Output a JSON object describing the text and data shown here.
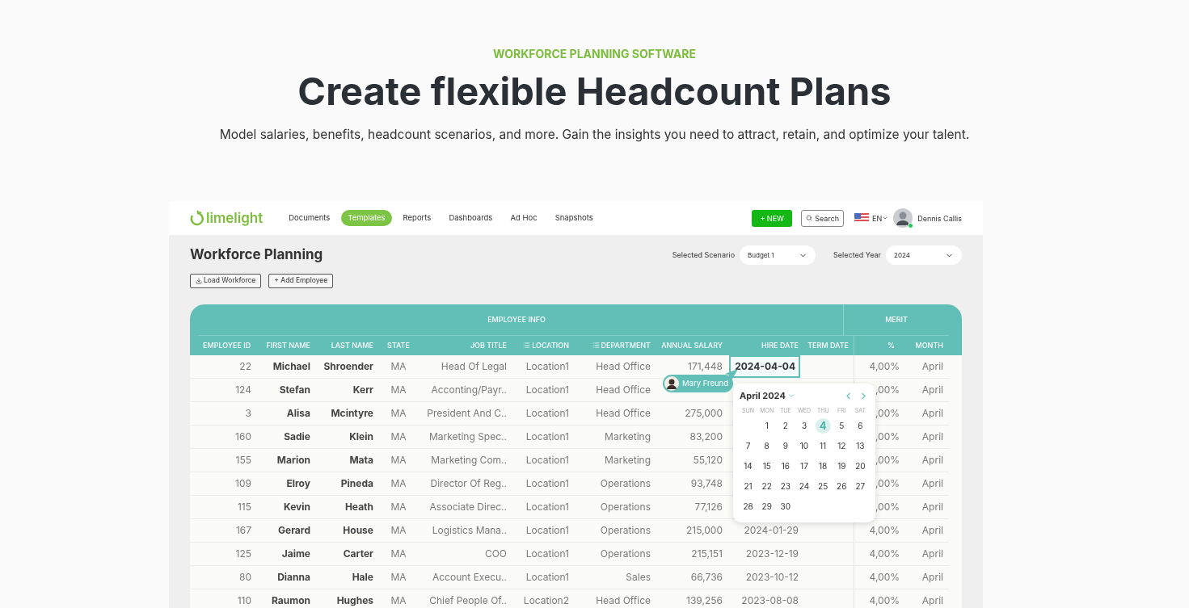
{
  "hero": {
    "eyebrow": "WORKFORCE PLANNING SOFTWARE",
    "title": "Create flexible Headcount Plans",
    "subtitle": "Model salaries, benefits, headcount scenarios, and more. Gain the insights you need to attract, retain, and optimize your talent."
  },
  "app": {
    "logo": "limelight",
    "nav": [
      {
        "label": "Documents",
        "selected": false
      },
      {
        "label": "Templates",
        "selected": true
      },
      {
        "label": "Reports",
        "selected": false
      },
      {
        "label": "Dashboards",
        "selected": false
      },
      {
        "label": "Ad Hoc",
        "selected": false
      },
      {
        "label": "Snapshots",
        "selected": false
      }
    ],
    "new_button": "+ NEW",
    "search_button": "Search",
    "language": "EN",
    "user": {
      "name": "Dennis Callis",
      "online": true
    },
    "page_title": "Workforce Planning",
    "filters": [
      {
        "label": "Selected Scenario",
        "value": "Budget 1"
      },
      {
        "label": "Selected Year",
        "value": "2024"
      }
    ],
    "actions": [
      {
        "label": "Load Workforce",
        "kind": "download"
      },
      {
        "label": "+ Add Employee",
        "kind": "plain"
      }
    ],
    "table": {
      "groups": [
        {
          "label": "EMPLOYEE INFO"
        },
        {
          "label": "MERIT"
        }
      ],
      "columns": [
        {
          "label": "EMPLOYEE ID",
          "list": false
        },
        {
          "label": "FIRST NAME",
          "list": false
        },
        {
          "label": "LAST NAME",
          "list": false
        },
        {
          "label": "STATE",
          "list": false
        },
        {
          "label": "JOB TITLE",
          "list": false
        },
        {
          "label": "LOCATION",
          "list": true
        },
        {
          "label": "DEPARTMENT",
          "list": true
        },
        {
          "label": "ANNUAL SALARY",
          "list": false
        },
        {
          "label": "HIRE DATE",
          "list": false
        },
        {
          "label": "TERM DATE",
          "list": false
        },
        {
          "label": "%",
          "list": false
        },
        {
          "label": "MONTH",
          "list": false
        }
      ],
      "rows": [
        {
          "cells": [
            "22",
            "Michael",
            "Shroender",
            "MA",
            "Head Of Legal",
            "Location1",
            "Head Office",
            "171,448",
            "2024-04-04",
            "",
            "4,00%",
            "April"
          ],
          "editing": true
        },
        {
          "cells": [
            "124",
            "Stefan",
            "Kerr",
            "MA",
            "Acconting/Payr..",
            "Location1",
            "Head Office",
            "",
            "",
            "",
            ",00%",
            "April"
          ],
          "editing": false
        },
        {
          "cells": [
            "3",
            "Alisa",
            "Mcintyre",
            "MA",
            "President And C..",
            "Location1",
            "Head Office",
            "275,000",
            "",
            "",
            ",00%",
            "April"
          ],
          "editing": false
        },
        {
          "cells": [
            "160",
            "Sadie",
            "Klein",
            "MA",
            "Marketing Spec..",
            "Location1",
            "Marketing",
            "83,200",
            "",
            "",
            ",00%",
            "April"
          ],
          "editing": false
        },
        {
          "cells": [
            "155",
            "Marion",
            "Mata",
            "MA",
            "Marketing Com..",
            "Location1",
            "Marketing",
            "55,120",
            "",
            "",
            ",00%",
            "April"
          ],
          "editing": false
        },
        {
          "cells": [
            "109",
            "Elroy",
            "Pineda",
            "MA",
            "Director Of Reg..",
            "Location1",
            "Operations",
            "93,748",
            "",
            "",
            ",00%",
            "April"
          ],
          "editing": false
        },
        {
          "cells": [
            "115",
            "Kevin",
            "Heath",
            "MA",
            "Associate Direc..",
            "Location1",
            "Operations",
            "77,126",
            "",
            "",
            ",00%",
            "April"
          ],
          "editing": false
        },
        {
          "cells": [
            "167",
            "Gerard",
            "House",
            "MA",
            "Logistics Mana..",
            "Location1",
            "Operations",
            "215,000",
            "2024-01-29",
            "",
            "4,00%",
            "April"
          ],
          "editing": false
        },
        {
          "cells": [
            "125",
            "Jaime",
            "Carter",
            "MA",
            "COO",
            "Location1",
            "Operations",
            "215,151",
            "2023-12-19",
            "",
            "4,00%",
            "April"
          ],
          "editing": false
        },
        {
          "cells": [
            "80",
            "Dianna",
            "Hale",
            "MA",
            "Account Execu..",
            "Location1",
            "Sales",
            "66,736",
            "2023-10-12",
            "",
            "4,00%",
            "April"
          ],
          "editing": false
        },
        {
          "cells": [
            "110",
            "Raumon",
            "Hughes",
            "MA",
            "Chief People Of..",
            "Location2",
            "Head Office",
            "139,256",
            "2023-08-08",
            "",
            "4,00%",
            "April"
          ],
          "editing": false
        }
      ]
    },
    "collaborator": "Mary Freund",
    "calendar": {
      "title": "April 2024",
      "weekdays": [
        "SUN",
        "MON",
        "TUE",
        "WED",
        "THU",
        "FRI",
        "SAT"
      ],
      "weeks": [
        [
          {
            "day": "1",
            "selected": false
          },
          {
            "day": "2",
            "selected": false
          },
          {
            "day": "3",
            "selected": false
          },
          {
            "day": "4",
            "selected": true
          },
          {
            "day": "5",
            "selected": false
          },
          {
            "day": "6",
            "selected": false
          }
        ],
        [
          {
            "day": "7",
            "selected": false
          },
          {
            "day": "8",
            "selected": false
          },
          {
            "day": "9",
            "selected": false
          },
          {
            "day": "10",
            "selected": false
          },
          {
            "day": "11",
            "selected": false
          },
          {
            "day": "12",
            "selected": false
          },
          {
            "day": "13",
            "selected": false
          }
        ],
        [
          {
            "day": "14",
            "selected": false
          },
          {
            "day": "15",
            "selected": false
          },
          {
            "day": "16",
            "selected": false
          },
          {
            "day": "17",
            "selected": false
          },
          {
            "day": "18",
            "selected": false
          },
          {
            "day": "19",
            "selected": false
          },
          {
            "day": "20",
            "selected": false
          }
        ],
        [
          {
            "day": "21",
            "selected": false
          },
          {
            "day": "22",
            "selected": false
          },
          {
            "day": "23",
            "selected": false
          },
          {
            "day": "24",
            "selected": false
          },
          {
            "day": "25",
            "selected": false
          },
          {
            "day": "26",
            "selected": false
          },
          {
            "day": "27",
            "selected": false
          }
        ],
        [
          {
            "day": "28",
            "selected": false
          },
          {
            "day": "29",
            "selected": false
          },
          {
            "day": "30",
            "selected": false
          }
        ]
      ]
    }
  }
}
